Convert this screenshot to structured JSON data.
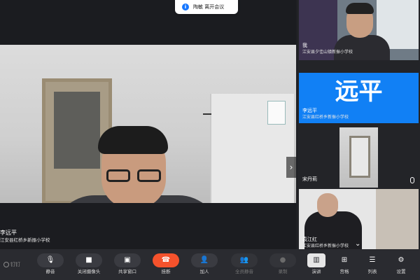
{
  "notification": {
    "icon": "info-icon",
    "text": "陶敏 离开会议"
  },
  "main_video": {
    "speaker_name": "李远平",
    "speaker_org": "江安县红桥乡新振小学校"
  },
  "participants": [
    {
      "name": "我",
      "org": "江安县夕佳山镇新振小学校"
    },
    {
      "name": "李远平",
      "org": "江安县红桥乡新振小学校",
      "avatar_text": "远平",
      "avatar_color": "#1180f5"
    },
    {
      "name": "宋丹莉",
      "org": ""
    },
    {
      "name": "袁江红",
      "org": "江安县红桥乡新振小学校"
    }
  ],
  "toolbar": {
    "brand": "钉钉",
    "buttons": [
      {
        "label": "静音",
        "icon": "microphone-icon"
      },
      {
        "label": "关闭摄像头",
        "icon": "camera-icon"
      },
      {
        "label": "共享窗口",
        "icon": "share-screen-icon"
      },
      {
        "label": "挂断",
        "icon": "hang-up-icon"
      },
      {
        "label": "加人",
        "icon": "add-person-icon"
      },
      {
        "label": "全员静音",
        "icon": "mute-all-icon"
      },
      {
        "label": "录制",
        "icon": "record-icon"
      }
    ],
    "views": [
      {
        "label": "演讲",
        "icon": "speaker-view-icon"
      },
      {
        "label": "宫格",
        "icon": "grid-view-icon"
      },
      {
        "label": "列表",
        "icon": "list-view-icon"
      },
      {
        "label": "设置",
        "icon": "settings-icon"
      }
    ],
    "danger_color": "#f5522c"
  }
}
